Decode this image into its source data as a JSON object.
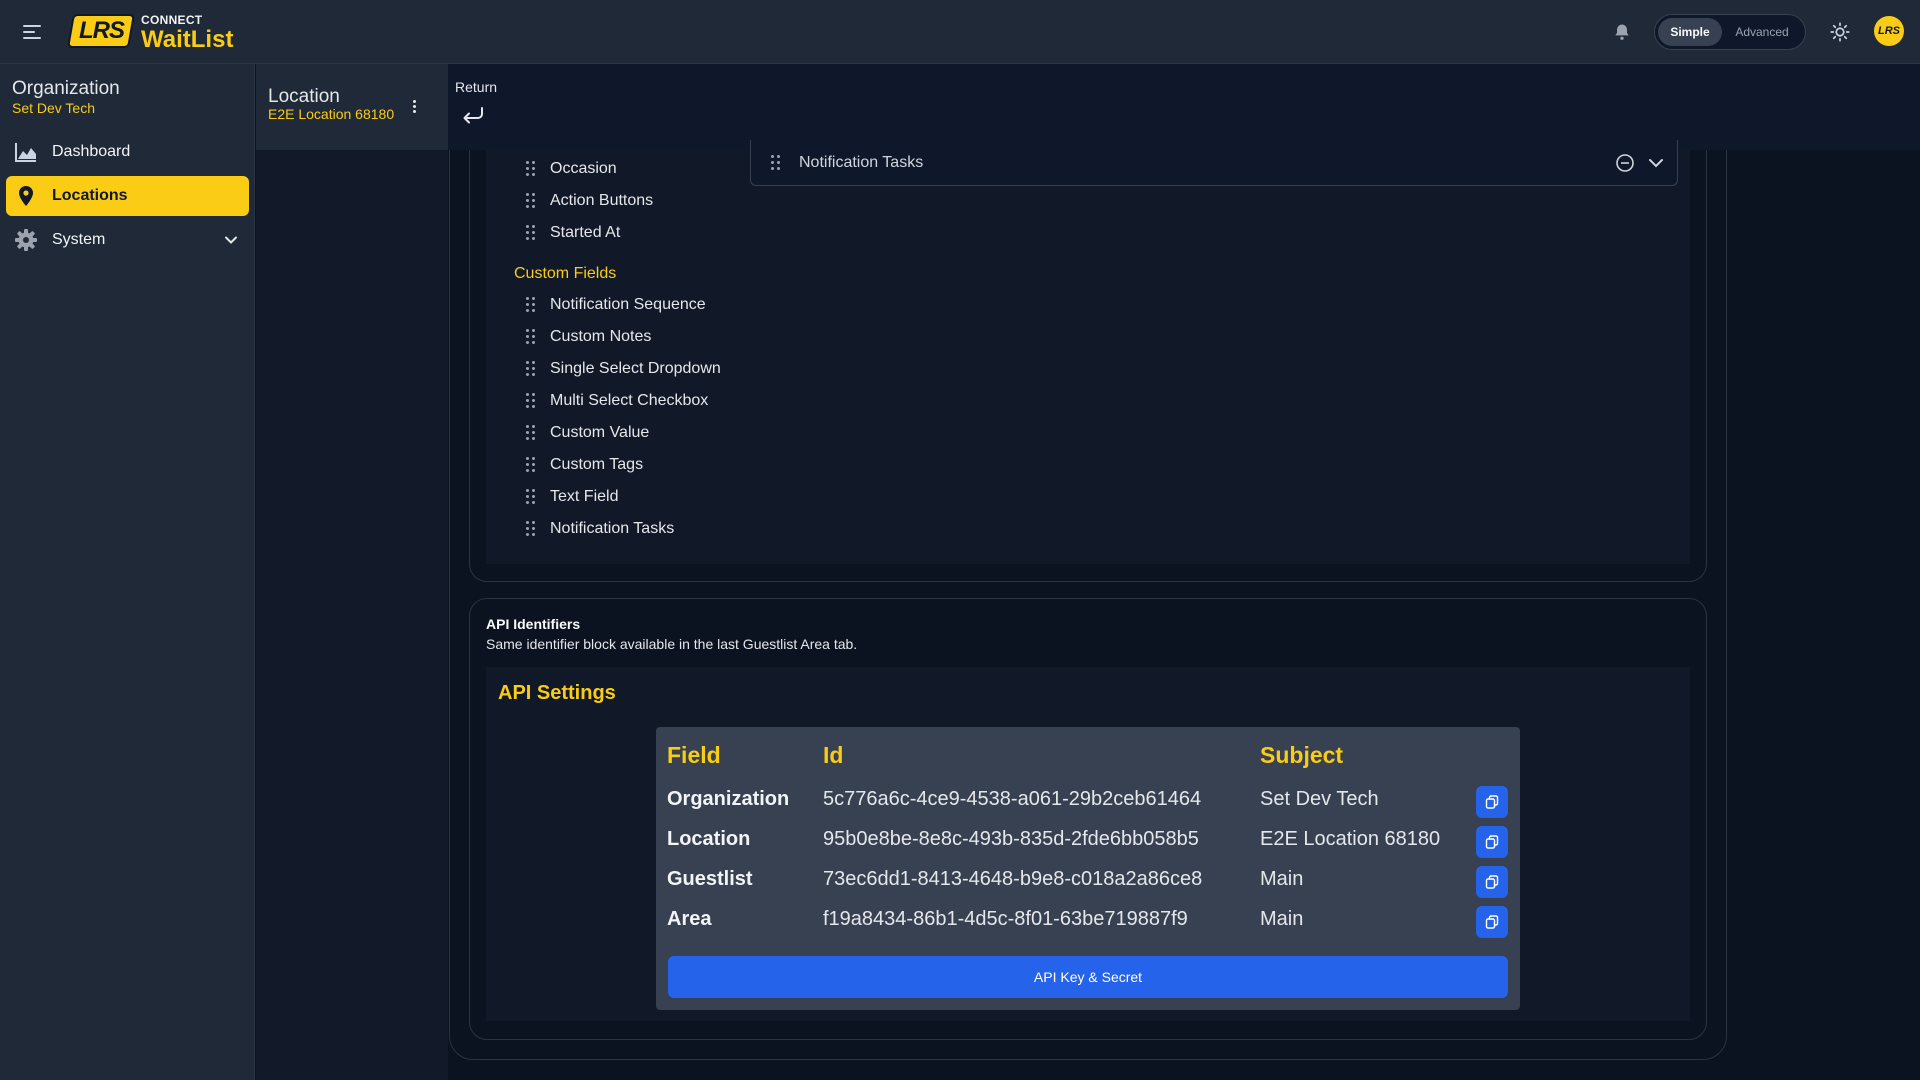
{
  "header": {
    "brand_small": "CONNECT",
    "brand_big": "WaitList",
    "logo_text": "LRS",
    "avatar_text": "LRS",
    "mode_simple": "Simple",
    "mode_advanced": "Advanced",
    "mode_selected": "Simple"
  },
  "sidebar": {
    "org_title": "Organization",
    "org_name": "Set Dev Tech",
    "items": [
      {
        "label": "Dashboard",
        "icon": "chart-area-icon",
        "active": false
      },
      {
        "label": "Locations",
        "icon": "map-pin-icon",
        "active": true
      },
      {
        "label": "System",
        "icon": "gear-icon",
        "active": false
      }
    ]
  },
  "location": {
    "title": "Location",
    "name": "E2E Location 68180",
    "return_label": "Return"
  },
  "fields": {
    "top": [
      "Occasion",
      "Action Buttons",
      "Started At"
    ],
    "custom_heading": "Custom Fields",
    "custom": [
      "Notification Sequence",
      "Custom Notes",
      "Single Select Dropdown",
      "Multi Select Checkbox",
      "Custom Value",
      "Custom Tags",
      "Text Field",
      "Notification Tasks"
    ],
    "selected": "Notification Tasks"
  },
  "api": {
    "title": "API Identifiers",
    "description": "Same identifier block available in the last Guestlist Area tab.",
    "settings_title": "API Settings",
    "columns": [
      "Field",
      "Id",
      "Subject"
    ],
    "rows": [
      {
        "field": "Organization",
        "id": "5c776a6c-4ce9-4538-a061-29b2ceb61464",
        "subject": "Set Dev Tech"
      },
      {
        "field": "Location",
        "id": "95b0e8be-8e8c-493b-835d-2fde6bb058b5",
        "subject": "E2E Location 68180"
      },
      {
        "field": "Guestlist",
        "id": "73ec6dd1-8413-4648-b9e8-c018a2a86ce8",
        "subject": "Main"
      },
      {
        "field": "Area",
        "id": "f19a8434-86b1-4d5c-8f01-63be719887f9",
        "subject": "Main"
      }
    ],
    "key_button": "API Key & Secret"
  },
  "colors": {
    "accent": "#facc15",
    "primary_button": "#2563eb",
    "background": "#0b1220",
    "surface": "#1f2937"
  }
}
